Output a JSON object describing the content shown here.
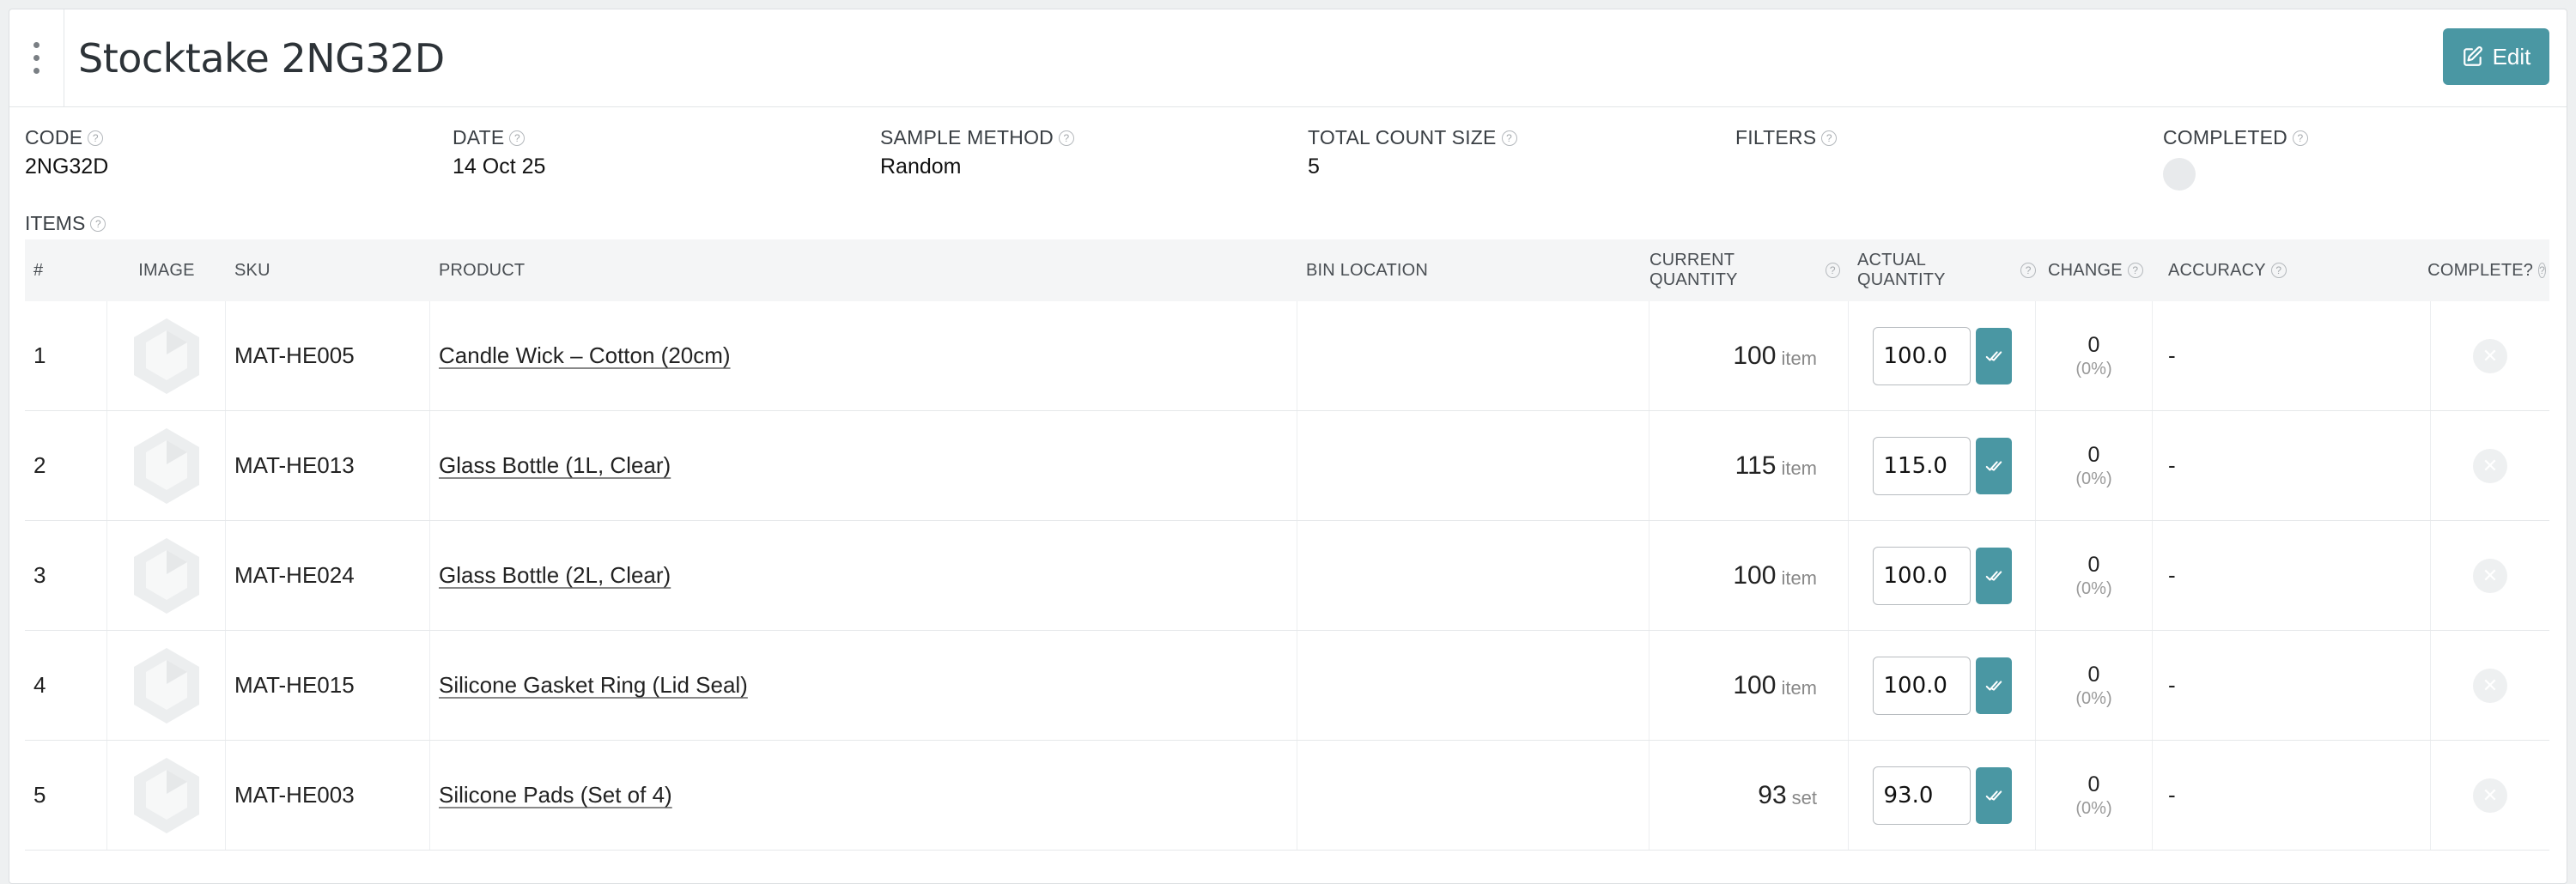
{
  "header": {
    "title": "Stocktake 2NG32D",
    "edit_label": "Edit"
  },
  "fields": {
    "code_label": "CODE",
    "code_value": "2NG32D",
    "date_label": "DATE",
    "date_value": "14 Oct 25",
    "sample_label": "SAMPLE METHOD",
    "sample_value": "Random",
    "total_label": "TOTAL COUNT SIZE",
    "total_value": "5",
    "filters_label": "FILTERS",
    "completed_label": "COMPLETED"
  },
  "items_label": "ITEMS",
  "table": {
    "headers": {
      "num": "#",
      "image": "IMAGE",
      "sku": "SKU",
      "product": "PRODUCT",
      "bin": "BIN LOCATION",
      "current": "CURRENT QUANTITY",
      "actual": "ACTUAL QUANTITY",
      "change": "CHANGE",
      "accuracy": "ACCURACY",
      "complete": "COMPLETE?"
    },
    "rows": [
      {
        "num": "1",
        "sku": "MAT-HE005",
        "product": "Candle Wick – Cotton (20cm)",
        "bin": "",
        "current": "100",
        "unit": "item",
        "actual": "100.0",
        "change": "0",
        "change_pct": "(0%)",
        "accuracy": "-"
      },
      {
        "num": "2",
        "sku": "MAT-HE013",
        "product": "Glass Bottle (1L, Clear)",
        "bin": "",
        "current": "115",
        "unit": "item",
        "actual": "115.0",
        "change": "0",
        "change_pct": "(0%)",
        "accuracy": "-"
      },
      {
        "num": "3",
        "sku": "MAT-HE024",
        "product": "Glass Bottle (2L, Clear)",
        "bin": "",
        "current": "100",
        "unit": "item",
        "actual": "100.0",
        "change": "0",
        "change_pct": "(0%)",
        "accuracy": "-"
      },
      {
        "num": "4",
        "sku": "MAT-HE015",
        "product": "Silicone Gasket Ring (Lid Seal)",
        "bin": "",
        "current": "100",
        "unit": "item",
        "actual": "100.0",
        "change": "0",
        "change_pct": "(0%)",
        "accuracy": "-"
      },
      {
        "num": "5",
        "sku": "MAT-HE003",
        "product": "Silicone Pads (Set of 4)",
        "bin": "",
        "current": "93",
        "unit": "set",
        "actual": "93.0",
        "change": "0",
        "change_pct": "(0%)",
        "accuracy": "-"
      }
    ]
  },
  "icons": {
    "menu": "kebab-menu-icon",
    "edit": "edit-icon",
    "help": "help-icon",
    "placeholder": "product-placeholder-icon",
    "confirm": "check-icon",
    "incomplete": "x-icon"
  },
  "colors": {
    "accent": "#4a97a3"
  }
}
